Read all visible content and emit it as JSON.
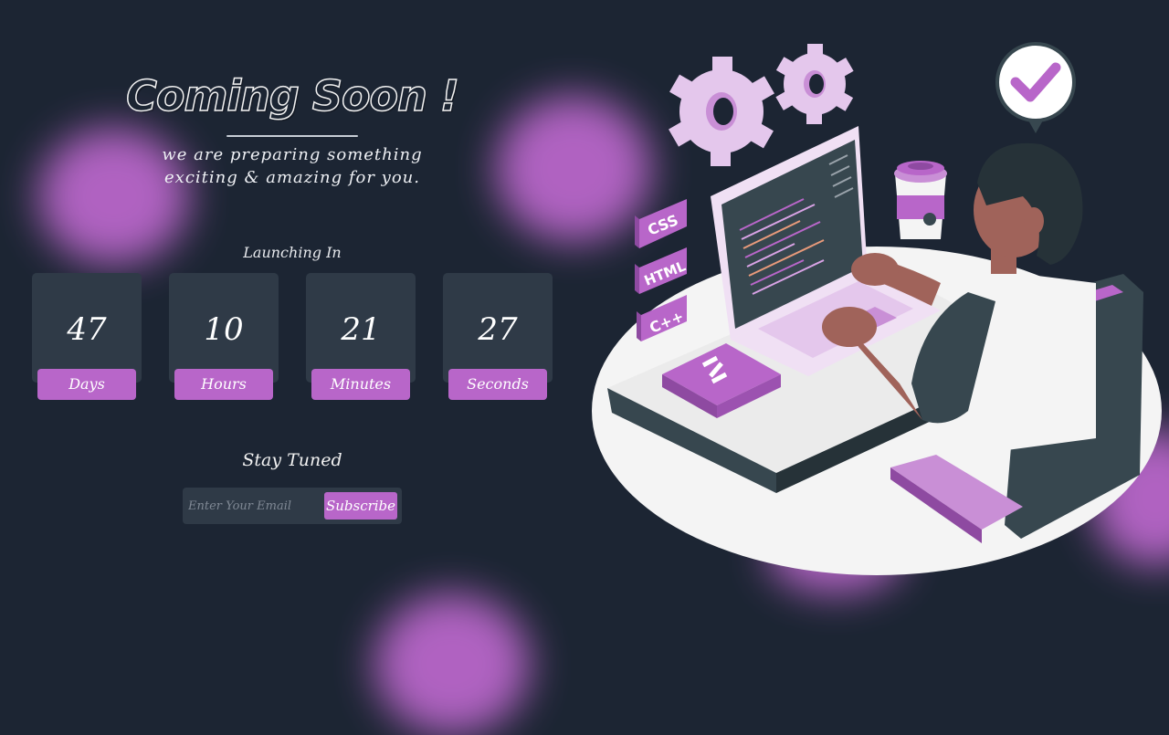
{
  "hero": {
    "title": "Coming Soon !",
    "subtitle": "we are preparing something exciting & amazing for you."
  },
  "countdown": {
    "label": "Launching In",
    "units": [
      {
        "value": "47",
        "label": "Days"
      },
      {
        "value": "10",
        "label": "Hours"
      },
      {
        "value": "21",
        "label": "Minutes"
      },
      {
        "value": "27",
        "label": "Seconds"
      }
    ]
  },
  "subscribe": {
    "label": "Stay Tuned",
    "placeholder": "Enter Your Email",
    "button_label": "Subscribe"
  },
  "illustration": {
    "badges": [
      "CSS",
      "HTML",
      "C++"
    ],
    "icons": [
      "gear-icon",
      "checkmark-icon",
      "coffee-cup-icon",
      "code-icon"
    ]
  },
  "colors": {
    "background": "#1c2533",
    "accent": "#b866c9",
    "tile": "#2f3a47"
  }
}
